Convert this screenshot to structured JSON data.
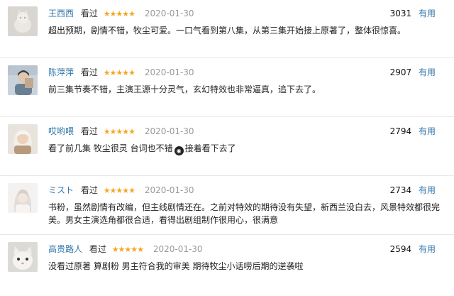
{
  "reviews": [
    {
      "username": "王西西",
      "status": "看过",
      "stars": "★★★★★",
      "date": "2020-01-30",
      "votes": "3031",
      "useful_label": "有用",
      "content": "超出预期，剧情不错，牧尘可爱。一口气看到第八集，从第三集开始接上原著了，整体很惊喜。",
      "avatar_icon": "cat-avatar-icon"
    },
    {
      "username": "陈萍萍",
      "status": "看过",
      "stars": "★★★★★",
      "date": "2020-01-30",
      "votes": "2907",
      "useful_label": "有用",
      "content": "前三集节奏不错，主演王源十分灵气，玄幻特效也非常逼真，追下去了。",
      "avatar_icon": "person-avatar-icon"
    },
    {
      "username": "哎哟喂",
      "status": "看过",
      "stars": "★★★★★",
      "date": "2020-01-30",
      "votes": "2794",
      "useful_label": "有用",
      "content_before": "看了前几集 牧尘很灵 台词也不错",
      "content_after": "接着看下去了",
      "avatar_icon": "woman-avatar-icon"
    },
    {
      "username": "ミスト",
      "status": "看过",
      "stars": "★★★★★",
      "date": "2020-01-30",
      "votes": "2734",
      "useful_label": "有用",
      "content": "书粉，虽然剧情有改编，但主线剧情还在。之前对特效的期待没有失望，新西兰没白去，风景特效都很完美。男女主演选角都很合适，看得出剧组制作很用心，很满意",
      "avatar_icon": "girl-avatar-icon"
    },
    {
      "username": "高贵路人",
      "status": "看过",
      "stars": "★★★★★",
      "date": "2020-01-30",
      "votes": "2594",
      "useful_label": "有用",
      "content": "没看过原著 算剧粉 男主符合我的审美 期待牧尘小话唠后期的逆袭啦",
      "avatar_icon": "cat-face-avatar-icon"
    }
  ],
  "colors": {
    "link": "#3377aa",
    "star": "#f5a623",
    "date": "#999999"
  }
}
